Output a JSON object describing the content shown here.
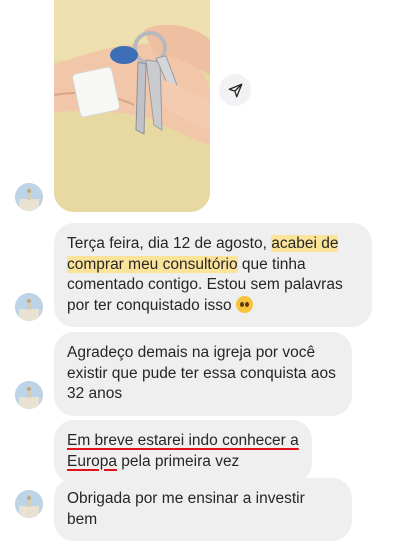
{
  "messages": {
    "m1": {
      "part1": "Terça feira, dia 12 de agosto, ",
      "highlight": "acabei de comprar meu consultório",
      "part2": " que tinha comentado contigo. Estou sem palavras por ter conquistado isso "
    },
    "m2": {
      "text": "Agradeço demais na igreja por você existir que pude ter essa conquista aos 32 anos"
    },
    "m3": {
      "underline1": "Em breve estarei indo conhecer a",
      "underline2": "Europa",
      "rest": " pela primeira vez"
    },
    "m4": {
      "text": "Obrigada por me ensinar a investir bem"
    }
  },
  "icons": {
    "share": "send-icon",
    "emoji": "pleading-face-emoji"
  },
  "colors": {
    "bubble": "#efeff0",
    "highlight": "#fbe49a",
    "underline": "#e0121b"
  }
}
